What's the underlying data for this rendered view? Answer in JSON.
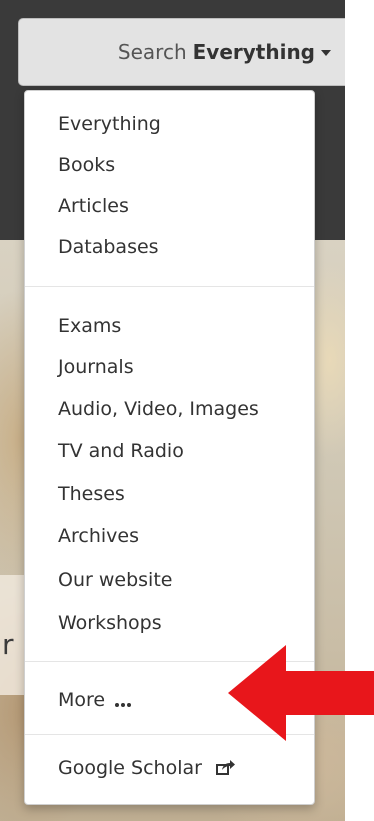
{
  "search_scope": {
    "prefix": "Search",
    "value": "Everything"
  },
  "menu": {
    "group1": [
      "Everything",
      "Books",
      "Articles",
      "Databases"
    ],
    "group2": [
      "Exams",
      "Journals",
      "Audio, Video, Images",
      "TV and Radio",
      "Theses",
      "Archives",
      "Our website",
      "Workshops"
    ],
    "more": "More",
    "google_scholar": "Google Scholar"
  },
  "background": {
    "fragment": "r"
  },
  "annotation": {
    "arrow_color": "#e8161b",
    "points_to": "More"
  },
  "icons": {
    "caret": "caret-down-icon",
    "more": "ellipsis-icon",
    "scholar": "share-external-icon"
  }
}
